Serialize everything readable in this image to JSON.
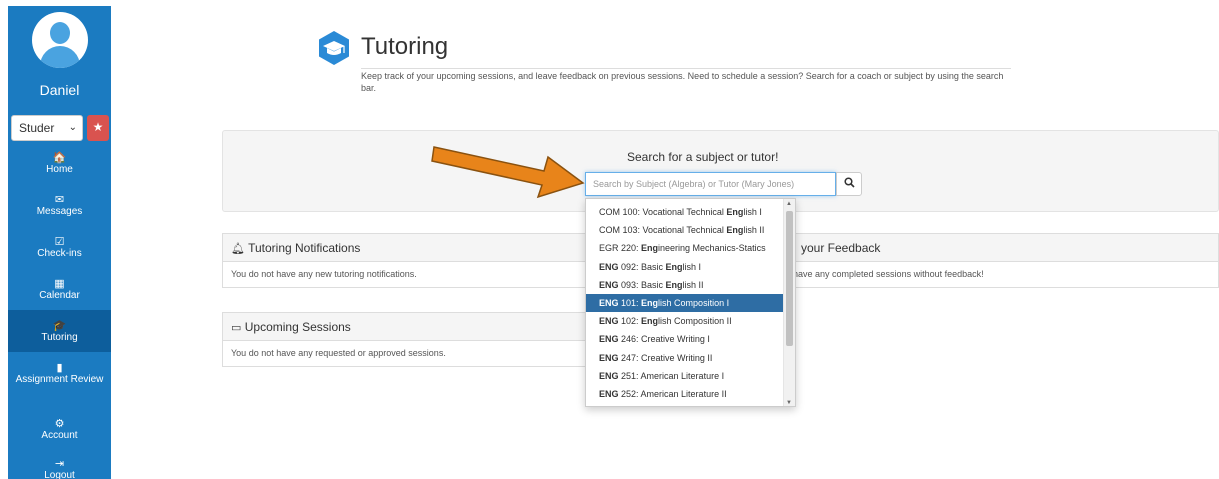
{
  "sidebar": {
    "username": "Daniel",
    "role_select": "Studer",
    "items": [
      {
        "label": "Home",
        "icon": "home-icon",
        "glyph": "🏠"
      },
      {
        "label": "Messages",
        "icon": "envelope-icon",
        "glyph": "✉"
      },
      {
        "label": "Check-ins",
        "icon": "checkbox-icon",
        "glyph": "☑"
      },
      {
        "label": "Calendar",
        "icon": "calendar-icon",
        "glyph": "▦"
      },
      {
        "label": "Tutoring",
        "icon": "graduation-cap-icon",
        "glyph": "🎓"
      },
      {
        "label": "Assignment Review",
        "icon": "file-icon",
        "glyph": "▮"
      },
      {
        "label": "Account",
        "icon": "gear-icon",
        "glyph": "⚙"
      },
      {
        "label": "Logout",
        "icon": "sign-out-icon",
        "glyph": "⇥"
      }
    ]
  },
  "header": {
    "title": "Tutoring",
    "subtitle": "Keep track of your upcoming sessions, and leave feedback on previous sessions. Need to schedule a session? Search for a coach or subject by using the search bar."
  },
  "search": {
    "heading": "Search for a subject or tutor!",
    "placeholder": "Search by Subject (Algebra) or Tutor (Mary Jones)"
  },
  "panels": {
    "notifications": {
      "title": "Tutoring Notifications",
      "body": "You do not have any new tutoring notifications."
    },
    "feedback": {
      "title": "your Feedback",
      "body": "have any completed sessions without feedback!"
    },
    "upcoming": {
      "title": "Upcoming Sessions",
      "body": "You do not have any requested or approved sessions."
    }
  },
  "dropdown": {
    "items": [
      {
        "pre": "COM 100: Vocational Technical ",
        "bold": "Eng",
        "post": "lish I",
        "code_bold": false
      },
      {
        "pre": "COM 103: Vocational Technical ",
        "bold": "Eng",
        "post": "lish II",
        "code_bold": false
      },
      {
        "pre": "EGR 220: ",
        "bold": "Eng",
        "post": "ineering Mechanics-Statics",
        "code_bold": false
      },
      {
        "code": "ENG",
        "pre": " 092: Basic ",
        "bold": "Eng",
        "post": "lish I",
        "code_bold": true
      },
      {
        "code": "ENG",
        "pre": " 093: Basic ",
        "bold": "Eng",
        "post": "lish II",
        "code_bold": true
      },
      {
        "code": "ENG",
        "pre": " 101: ",
        "bold": "Eng",
        "post": "lish Composition I",
        "code_bold": true
      },
      {
        "code": "ENG",
        "pre": " 102: ",
        "bold": "Eng",
        "post": "lish Composition II",
        "code_bold": true
      },
      {
        "code": "ENG",
        "pre": " 246: Creative Writing I",
        "bold": "",
        "post": "",
        "code_bold": true
      },
      {
        "code": "ENG",
        "pre": " 247: Creative Writing II",
        "bold": "",
        "post": "",
        "code_bold": true
      },
      {
        "code": "ENG",
        "pre": " 251: American Literature I",
        "bold": "",
        "post": "",
        "code_bold": true
      },
      {
        "code": "ENG",
        "pre": " 252: American Literature II",
        "bold": "",
        "post": "",
        "code_bold": true
      }
    ],
    "selected_index": 5
  },
  "colors": {
    "sidebar": "#1b7bc1",
    "sidebar_active": "#0d5e9c",
    "dropdown_selected": "#2e6da4",
    "arrow": "#e8841a",
    "favorite_button": "#d9534f"
  }
}
